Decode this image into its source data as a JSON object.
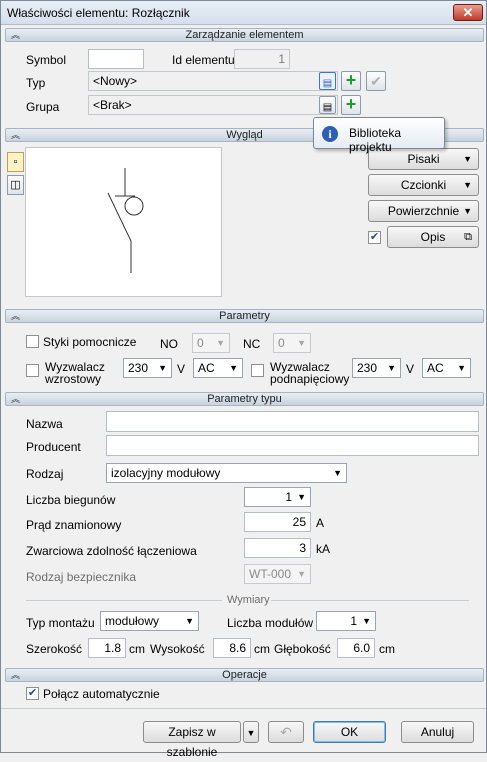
{
  "window": {
    "title": "Właściwości elementu: Rozłącznik",
    "close_glyph": "✕"
  },
  "sections": {
    "management": "Zarządzanie elementem",
    "appearance": "Wygląd",
    "parameters": "Parametry",
    "type_parameters": "Parametry typu",
    "operations": "Operacje"
  },
  "management": {
    "symbol_label": "Symbol",
    "symbol_value": "",
    "id_label": "Id elementu",
    "id_value": "1",
    "type_label": "Typ",
    "type_value": "<Nowy>",
    "group_label": "Grupa",
    "group_value": "<Brak>"
  },
  "tooltip": {
    "text": "Biblioteka projektu",
    "icon": "info-icon"
  },
  "appearance": {
    "buttons": {
      "pens": "Pisaki",
      "fonts": "Czcionki",
      "surfaces": "Powierzchnie",
      "description": "Opis"
    },
    "description_checked": true,
    "tabs": [
      "symbol-2d-icon",
      "symbol-3d-icon"
    ]
  },
  "parameters": {
    "aux_contacts_label": "Styki pomocnicze",
    "aux_contacts_checked": false,
    "no_label": "NO",
    "no_value": "0",
    "nc_label": "NC",
    "nc_value": "0",
    "trip_label_1": "Wyzwalacz",
    "trip_label_2": "wzrostowy",
    "trip_checked": false,
    "trip_voltage": "230",
    "trip_unit": "V",
    "trip_current": "AC",
    "undervolt_label_1": "Wyzwalacz",
    "undervolt_label_2": "podnapięciowy",
    "undervolt_checked": false,
    "undervolt_voltage": "230",
    "undervolt_unit": "V",
    "undervolt_current": "AC"
  },
  "type_parameters": {
    "name_label": "Nazwa",
    "name_value": "",
    "producer_label": "Producent",
    "producer_value": "",
    "kind_label": "Rodzaj",
    "kind_value": "izolacyjny modułowy",
    "poles_label": "Liczba biegunów",
    "poles_value": "1",
    "current_label": "Prąd znamionowy",
    "current_value": "25",
    "current_unit": "A",
    "short_label": "Zwarciowa zdolność łączeniowa",
    "short_value": "3",
    "short_unit": "kA",
    "fuse_label": "Rodzaj bezpiecznika",
    "fuse_value": "WT-000"
  },
  "dimensions": {
    "title": "Wymiary",
    "mount_label": "Typ montażu",
    "mount_value": "modułowy",
    "modules_label": "Liczba modułów",
    "modules_value": "1",
    "width_label": "Szerokość",
    "width_value": "1.8",
    "height_label": "Wysokość",
    "height_value": "8.6",
    "depth_label": "Głębokość",
    "depth_value": "6.0",
    "unit": "cm"
  },
  "operations": {
    "auto_connect_label": "Połącz automatycznie",
    "auto_connect_checked": true
  },
  "footer": {
    "save_template": "Zapisz w szablonie",
    "ok": "OK",
    "cancel": "Anuluj"
  },
  "colors": {
    "accent": "#2b5fb8",
    "add_green": "#1e9d2b",
    "header_bg": "#c8d2de"
  }
}
